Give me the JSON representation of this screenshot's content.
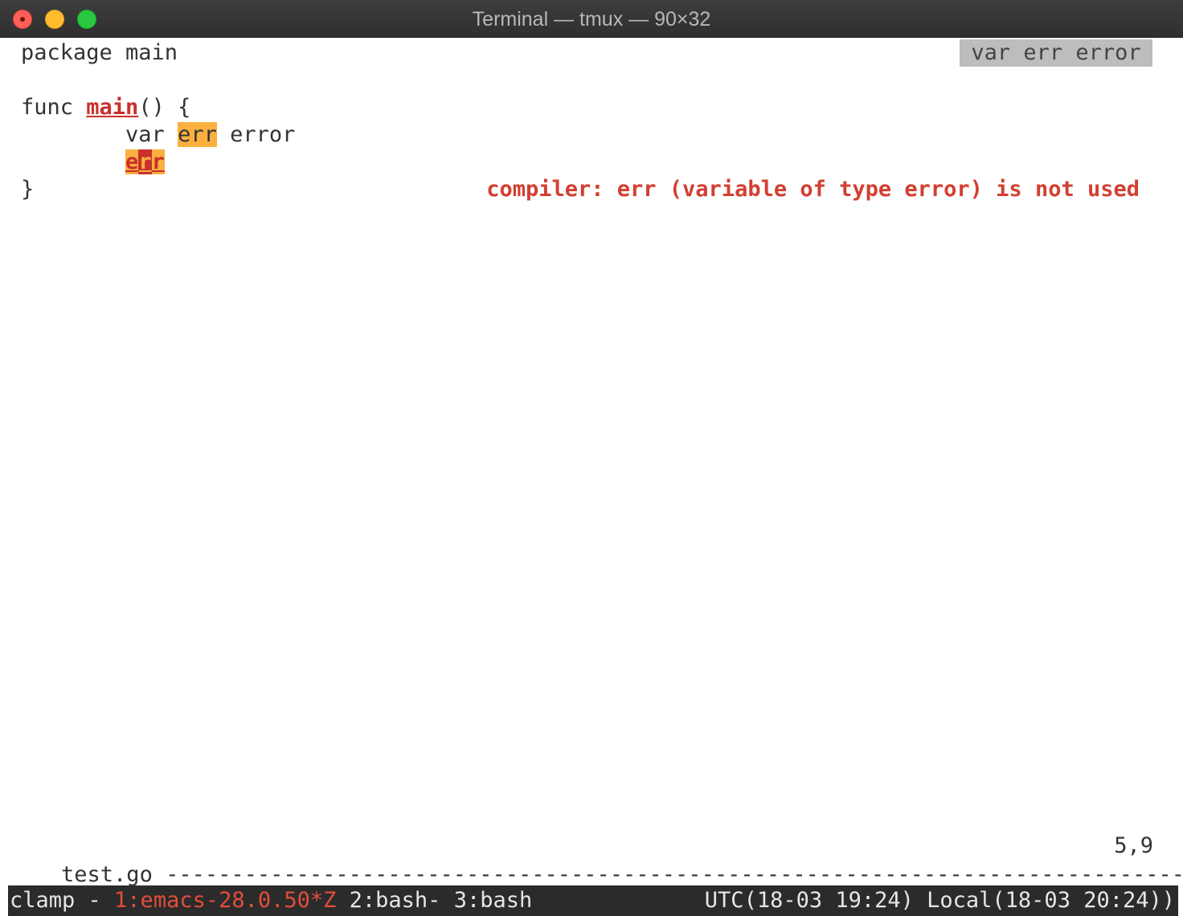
{
  "window": {
    "title": "Terminal — tmux — 90×32"
  },
  "editor": {
    "lines": {
      "l1": "package main",
      "l3_kw": "func ",
      "l3_fn": "main",
      "l3_rest": "() {",
      "l4_indent": "        ",
      "l4_kw": "var ",
      "l4_hl": "err",
      "l4_rest": " error",
      "l5_indent": "        ",
      "l5_a": "e",
      "l5_cursor": "r",
      "l5_b": "r",
      "l6": "}"
    },
    "eldoc": "var err error",
    "diagnostic": "compiler: err (variable of type error) is not used"
  },
  "modeline": {
    "file": "test.go",
    "dashes": "------------------------------------------------------------------------------*",
    "position": "5,9"
  },
  "tmux": {
    "session": "clamp - ",
    "window_active": "1:emacs-28.0.50*Z",
    "window_others": " 2:bash- 3:bash",
    "clock": "UTC(18-03 19:24) Local(18-03 20:24))"
  },
  "colors": {
    "highlight": "#fbb040",
    "error": "#d23f31",
    "tmux_bg": "#2b2b2b"
  }
}
